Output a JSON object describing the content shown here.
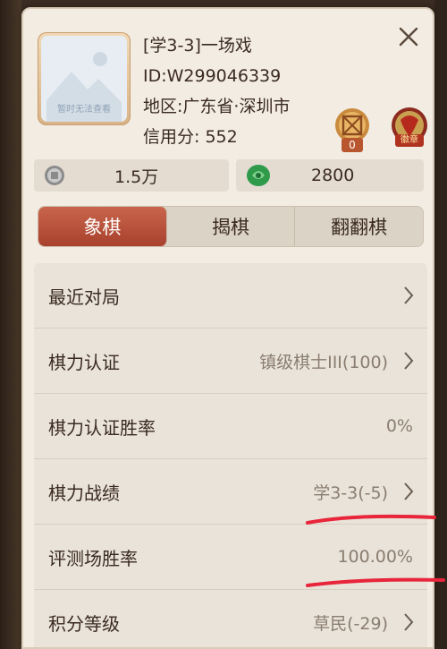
{
  "profile": {
    "name": "[学3-3]一场戏",
    "id_text": "ID:W299046339",
    "region_text": "地区:广东省·深圳市",
    "credit_text": "信用分: 552",
    "avatar_caption": "暂时无法查看"
  },
  "badges": {
    "rank_count": "0",
    "medal_label": "徽章"
  },
  "currency": {
    "coins": "1.5万",
    "jade": "2800"
  },
  "tabs": [
    {
      "label": "象棋",
      "active": true
    },
    {
      "label": "揭棋",
      "active": false
    },
    {
      "label": "翻翻棋",
      "active": false
    }
  ],
  "rows": [
    {
      "label": "最近对局",
      "value": "",
      "arrow": true
    },
    {
      "label": "棋力认证",
      "value": "镇级棋士III(100)",
      "arrow": true
    },
    {
      "label": "棋力认证胜率",
      "value": "0%",
      "arrow": false
    },
    {
      "label": "棋力战绩",
      "value": "学3-3(-5)",
      "arrow": true
    },
    {
      "label": "评测场胜率",
      "value": "100.00%",
      "arrow": false
    },
    {
      "label": "积分等级",
      "value": "草民(-29)",
      "arrow": true
    }
  ],
  "colors": {
    "active_tab": "#b24d36",
    "panel_bg": "#f2ece3",
    "annotation_red": "#e8253a"
  }
}
